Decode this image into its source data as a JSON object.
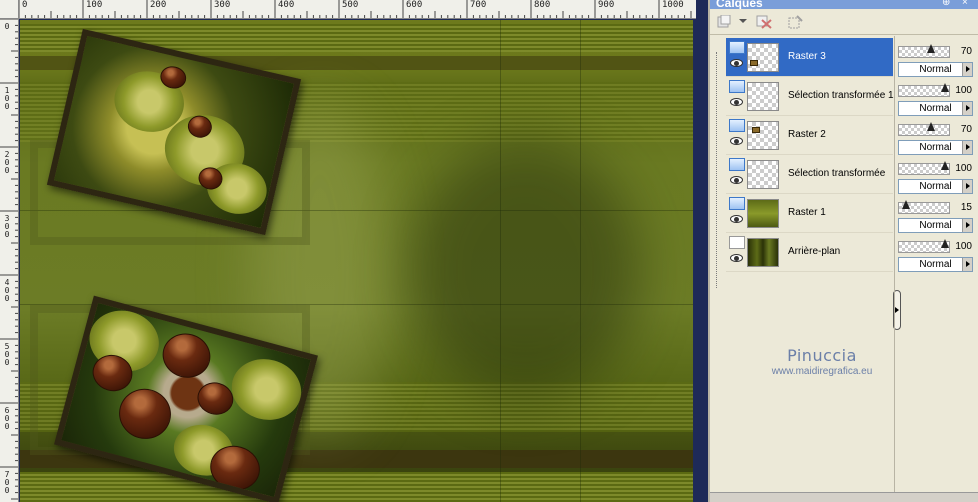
{
  "palette": {
    "title": "Calques",
    "pin_glyph": "⊕",
    "close_glyph": "×"
  },
  "ruler": {
    "top_labels": [
      "0",
      "100",
      "200",
      "300",
      "400",
      "500",
      "600",
      "700",
      "800",
      "900",
      "1000"
    ],
    "left_labels": [
      "0",
      "100",
      "200",
      "300",
      "400",
      "500",
      "600",
      "700"
    ]
  },
  "layers": [
    {
      "name": "Raster 3",
      "selected": true,
      "opacity": "70",
      "blend": "Normal",
      "thumb": "transparent-chestnut"
    },
    {
      "name": "Sélection transformée 1",
      "selected": false,
      "opacity": "100",
      "blend": "Normal",
      "thumb": "transparent"
    },
    {
      "name": "Raster 2",
      "selected": false,
      "opacity": "70",
      "blend": "Normal",
      "thumb": "transparent-chestnut"
    },
    {
      "name": "Sélection transformée",
      "selected": false,
      "opacity": "100",
      "blend": "Normal",
      "thumb": "transparent"
    },
    {
      "name": "Raster 1",
      "selected": false,
      "opacity": "15",
      "blend": "Normal",
      "thumb": "green-texture"
    },
    {
      "name": "Arrière-plan",
      "selected": false,
      "opacity": "100",
      "blend": "Normal",
      "thumb": "dark-green"
    }
  ],
  "watermark": {
    "name": "Pinuccia",
    "url": "www.maidiregrafica.eu"
  },
  "colors": {
    "selection": "#316ac5",
    "palette_bg": "#ece9d8",
    "title_bar": "#7a9ed9"
  }
}
